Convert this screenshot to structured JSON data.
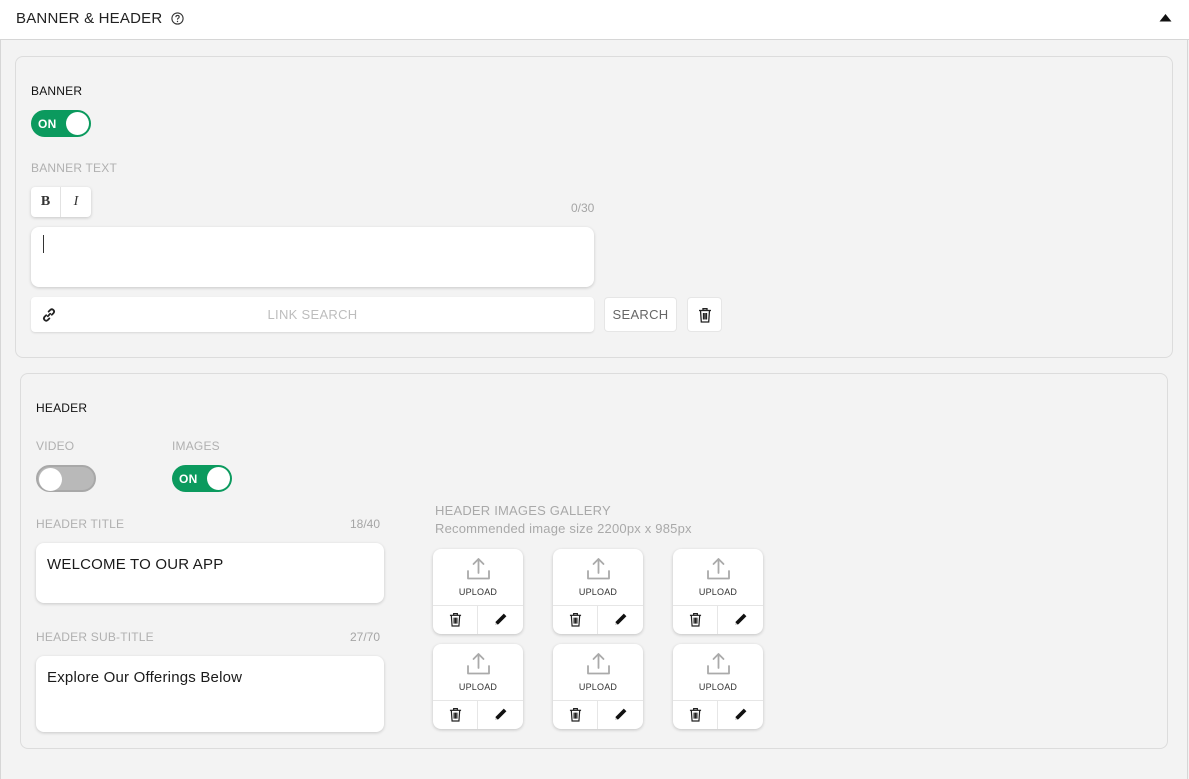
{
  "header_bar": {
    "title": "BANNER & HEADER",
    "help_icon": "help-circle-icon",
    "collapse_icon": "caret-up-icon"
  },
  "banner": {
    "section_title": "BANNER",
    "toggle_label": "ON",
    "banner_text_label": "BANNER TEXT",
    "bold_label": "B",
    "italic_label": "I",
    "char_count": "0/30",
    "text_value": "",
    "link_search_placeholder": "LINK SEARCH",
    "search_button_label": "SEARCH",
    "link_icon": "link-icon",
    "delete_icon": "trash-icon"
  },
  "header": {
    "section_title": "HEADER",
    "video_label": "VIDEO",
    "images_label": "IMAGES",
    "images_toggle_label": "ON",
    "video_toggle_label": "",
    "title_label": "HEADER TITLE",
    "title_count": "18/40",
    "title_value": "WELCOME TO OUR APP",
    "subtitle_label": "HEADER SUB-TITLE",
    "subtitle_count": "27/70",
    "subtitle_value": "Explore Our Offerings Below",
    "gallery_title": "HEADER IMAGES GALLERY",
    "gallery_subtitle": "Recommended image size 2200px x 985px",
    "upload_label": "UPLOAD",
    "tile_icons": [
      "upload-icon",
      "trash-icon",
      "pencil-icon"
    ]
  },
  "colors": {
    "toggle_on": "#0b9a5e",
    "toggle_off": "#b9b9b9",
    "background": "#f3f3f3"
  }
}
